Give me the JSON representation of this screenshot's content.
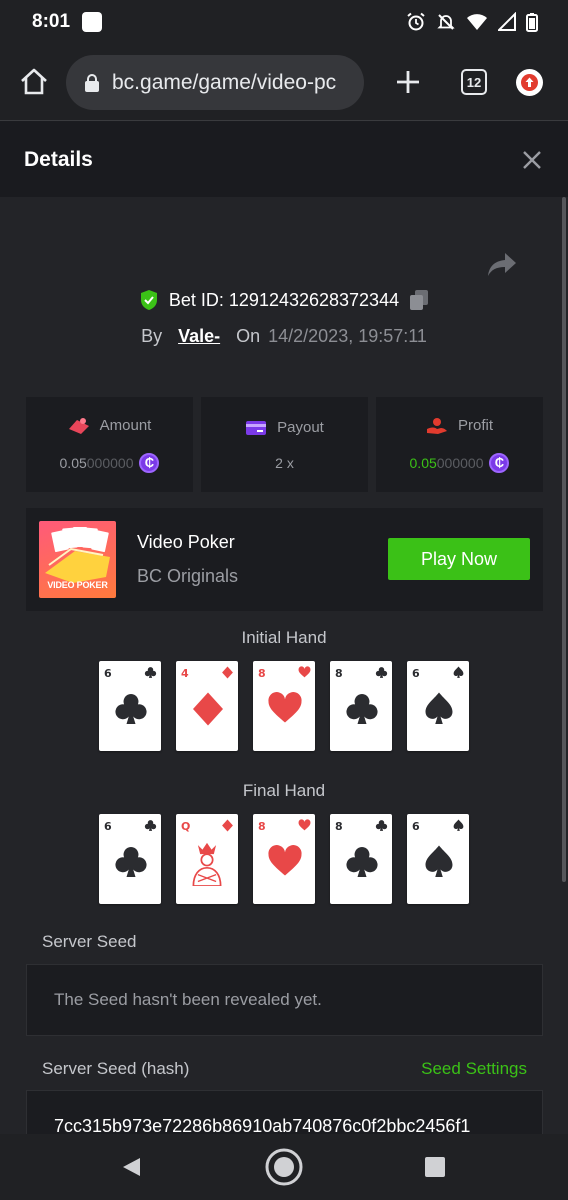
{
  "status": {
    "time": "8:01"
  },
  "browser": {
    "url": "bc.game/game/video-pc",
    "tab_count": "12"
  },
  "dialog": {
    "title": "Details"
  },
  "bet": {
    "id_label": "Bet ID: 12912432628372344",
    "by_label": "By",
    "user": "Vale-",
    "on_label": "On",
    "date": "14/2/2023, 19:57:11"
  },
  "stats": {
    "amount": {
      "label": "Amount",
      "value_main": "0.05",
      "value_dim": "000000"
    },
    "payout": {
      "label": "Payout",
      "value": "2 x"
    },
    "profit": {
      "label": "Profit",
      "value_main": "0.05",
      "value_dim": "000000"
    }
  },
  "game": {
    "name": "Video Poker",
    "provider": "BC Originals",
    "thumb_label": "VIDEO POKER",
    "play_label": "Play Now"
  },
  "hands": {
    "initial_label": "Initial Hand",
    "final_label": "Final Hand",
    "initial": [
      {
        "rank": "6",
        "suit": "club",
        "color": "black"
      },
      {
        "rank": "4",
        "suit": "diamond",
        "color": "red"
      },
      {
        "rank": "8",
        "suit": "heart",
        "color": "red"
      },
      {
        "rank": "8",
        "suit": "club",
        "color": "black"
      },
      {
        "rank": "6",
        "suit": "spade",
        "color": "black"
      }
    ],
    "final": [
      {
        "rank": "6",
        "suit": "club",
        "color": "black"
      },
      {
        "rank": "Q",
        "suit": "diamond",
        "color": "red",
        "face": true
      },
      {
        "rank": "8",
        "suit": "heart",
        "color": "red"
      },
      {
        "rank": "8",
        "suit": "club",
        "color": "black"
      },
      {
        "rank": "6",
        "suit": "spade",
        "color": "black"
      }
    ]
  },
  "seeds": {
    "server_label": "Server Seed",
    "server_value": "The Seed hasn't been revealed yet.",
    "hash_label": "Server Seed (hash)",
    "settings_label": "Seed Settings",
    "hash_value": "7cc315b973e72286b86910ab740876c0f2bbc2456f1"
  },
  "colors": {
    "accent": "#3bc117",
    "coin": "#7b3ae8",
    "background": "#232428"
  }
}
